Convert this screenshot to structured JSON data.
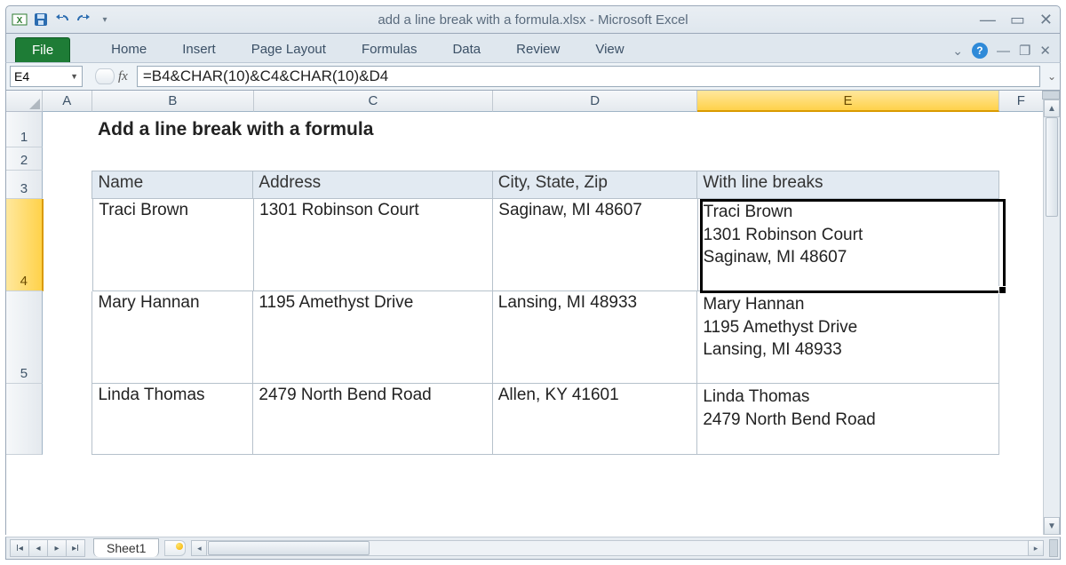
{
  "window": {
    "title": "add a line break with a formula.xlsx  -  Microsoft Excel"
  },
  "ribbon": {
    "file": "File",
    "tabs": [
      "Home",
      "Insert",
      "Page Layout",
      "Formulas",
      "Data",
      "Review",
      "View"
    ]
  },
  "namebox": "E4",
  "fx_label": "fx",
  "formula": "=B4&CHAR(10)&C4&CHAR(10)&D4",
  "columns": [
    "A",
    "B",
    "C",
    "D",
    "E",
    "F"
  ],
  "selected_col": "E",
  "selected_row": "4",
  "row_headers": [
    "1",
    "2",
    "3",
    "4",
    "5"
  ],
  "title_cell": "Add a line break with a formula",
  "table": {
    "headers": [
      "Name",
      "Address",
      "City, State, Zip",
      "With line breaks"
    ],
    "rows": [
      {
        "name": "Traci Brown",
        "address": "1301 Robinson Court",
        "csz": "Saginaw, MI 48607",
        "combined": "Traci Brown\n1301 Robinson Court\nSaginaw, MI 48607"
      },
      {
        "name": "Mary Hannan",
        "address": "1195 Amethyst Drive",
        "csz": "Lansing, MI 48933",
        "combined": "Mary Hannan\n1195 Amethyst Drive\nLansing, MI 48933"
      },
      {
        "name": "Linda Thomas",
        "address": "2479 North Bend Road",
        "csz": "Allen, KY 41601",
        "combined": "Linda Thomas\n2479 North Bend Road"
      }
    ]
  },
  "sheet_tab": "Sheet1"
}
